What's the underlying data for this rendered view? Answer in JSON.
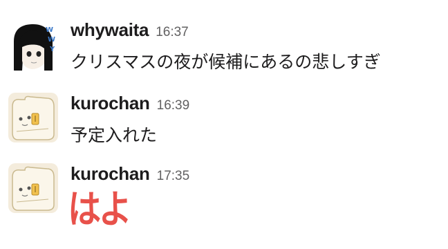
{
  "messages": [
    {
      "avatar_icon": "girl-avatar-icon",
      "username": "whywaita",
      "timestamp": "16:37",
      "text": "クリスマスの夜が候補にあるの悲しすぎ"
    },
    {
      "avatar_icon": "bread-character-avatar-icon",
      "username": "kurochan",
      "timestamp": "16:39",
      "text": "予定入れた"
    },
    {
      "avatar_icon": "bread-character-avatar-icon",
      "username": "kurochan",
      "timestamp": "17:35",
      "sticker_text": "はよ",
      "sticker_color": "#e8514a"
    }
  ]
}
